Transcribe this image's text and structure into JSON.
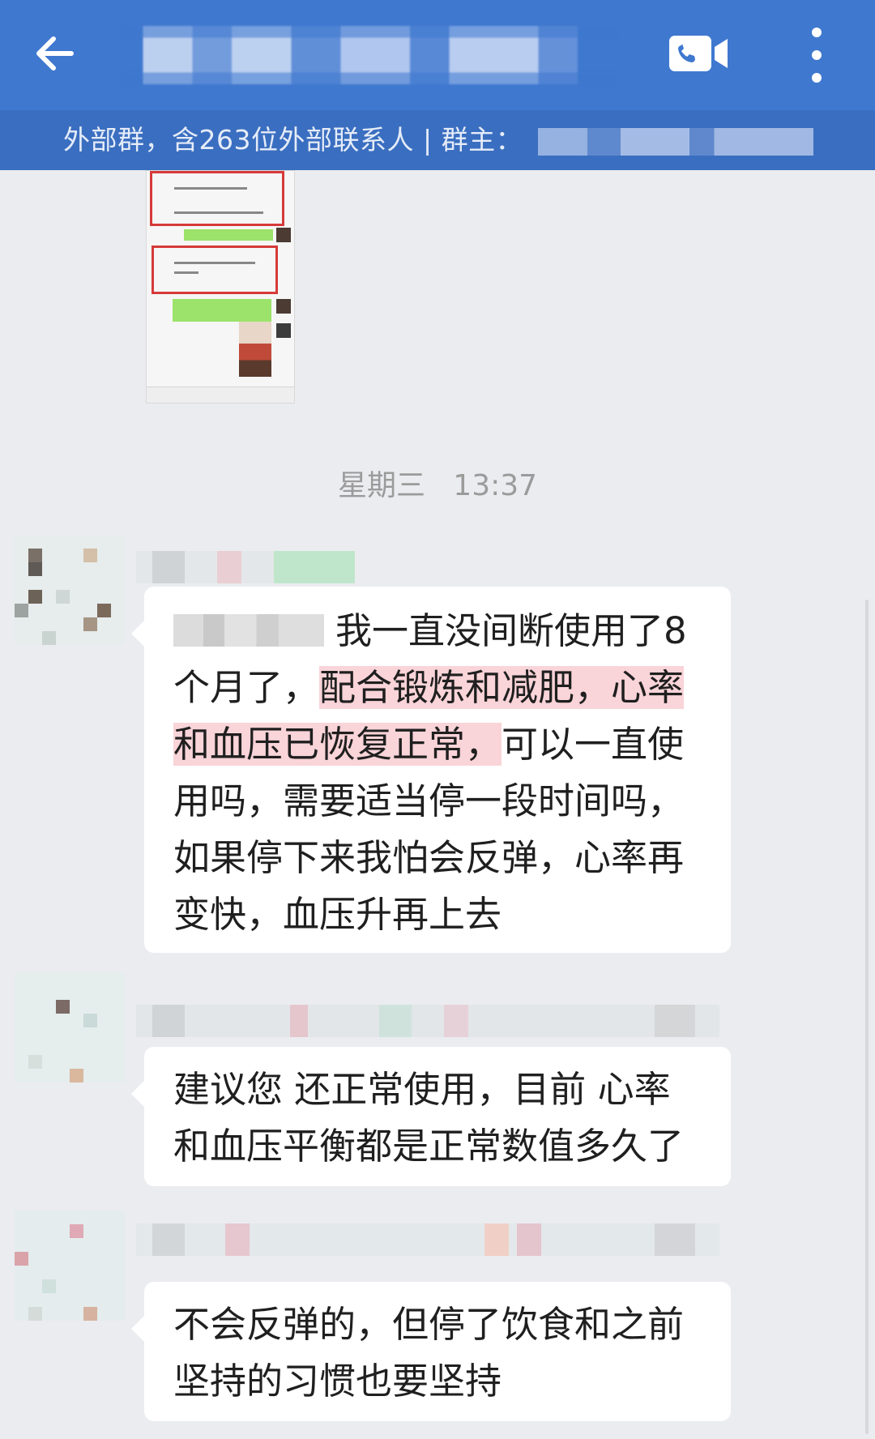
{
  "header": {
    "title_blurred": true
  },
  "subheader": {
    "text": "外部群，含263位外部联系人 | 群主："
  },
  "timestamp": {
    "day": "星期三",
    "time": "13:37"
  },
  "messages": [
    {
      "lines": [
        {
          "parts": [
            {
              "text": "我一直没间断使用了8"
            }
          ],
          "mention": true
        },
        {
          "parts": [
            {
              "text": "个月了，"
            },
            {
              "text": "配合锻炼和减肥，心率",
              "hl": true
            }
          ]
        },
        {
          "parts": [
            {
              "text": "和血压已恢复正常，",
              "hl": true
            },
            {
              "text": "可以一直使"
            }
          ]
        },
        {
          "parts": [
            {
              "text": "用吗，需要适当停一段时间吗，"
            }
          ]
        },
        {
          "parts": [
            {
              "text": "如果停下来我怕会反弹，心率再"
            }
          ]
        },
        {
          "parts": [
            {
              "text": "变快，血压升再上去"
            }
          ]
        }
      ]
    },
    {
      "lines": [
        {
          "parts": [
            {
              "text": "建议您 还正常使用，目前 心率"
            }
          ]
        },
        {
          "parts": [
            {
              "text": "和血压平衡都是正常数值多久了"
            }
          ]
        }
      ]
    },
    {
      "lines": [
        {
          "parts": [
            {
              "text": "不会反弹的，但停了饮食和之前"
            }
          ]
        },
        {
          "parts": [
            {
              "text": "坚持的习惯也要坚持"
            }
          ]
        }
      ]
    }
  ],
  "icons": {
    "back": "arrow-left-icon",
    "video": "video-call-icon",
    "more": "more-vertical-icon"
  },
  "colors": {
    "header_bg": "#3f78cf",
    "subheader_bg": "#3a6ec0",
    "chat_bg": "#ebecf0",
    "bubble_bg": "#ffffff",
    "highlight": "#f9d4d8",
    "timestamp": "#9b9b9b"
  }
}
